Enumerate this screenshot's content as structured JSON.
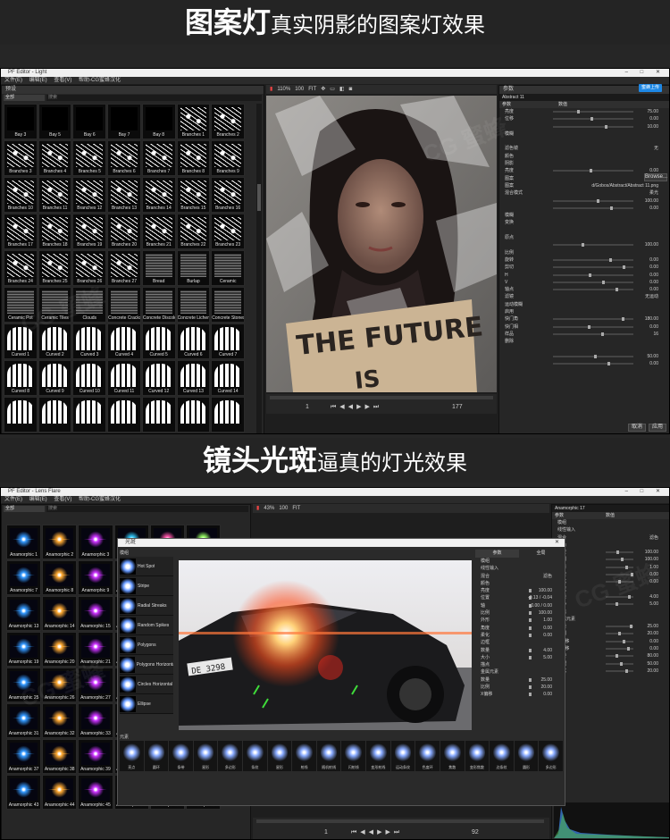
{
  "banner1": {
    "bold": "图案灯",
    "normal": "真实阴影的图案灯效果"
  },
  "banner2": {
    "bold": "镜头光斑",
    "normal": "逼真的灯光效果"
  },
  "shot1": {
    "title": "PF Editor - Light",
    "menu": [
      "文件(E)",
      "编辑(E)",
      "查看(V)",
      "帮助-CG蜜蜂汉化"
    ],
    "presets_title": "预设",
    "filter_value": "全部",
    "search_placeholder": "搜索",
    "toolbar": {
      "zoom": "110%",
      "size": "100",
      "fit": "FIT"
    },
    "gobos": [
      "Bay 3",
      "Bay 5",
      "Bay 6",
      "Bay 7",
      "Bay 8",
      "Branches 1",
      "Branches 2",
      "Branches 3",
      "Branches 4",
      "Branches 5",
      "Branches 6",
      "Branches 7",
      "Branches 8",
      "Branches 9",
      "Branches 10",
      "Branches 11",
      "Branches 12",
      "Branches 13",
      "Branches 14",
      "Branches 15",
      "Branches 16",
      "Branches 17",
      "Branches 18",
      "Branches 19",
      "Branches 20",
      "Branches 21",
      "Branches 22",
      "Branches 23",
      "Branches 24",
      "Branches 25",
      "Branches 26",
      "Branches 27",
      "Bread",
      "Burlap",
      "Ceramic",
      "Ceramic Pot",
      "Ceramic Tiles",
      "Clouds",
      "Concrete Cracks",
      "Concrete Discolored",
      "Concrete Lichens",
      "Concrete Stones",
      "Curved 1",
      "Curved 2",
      "Curved 3",
      "Curved 4",
      "Curved 5",
      "Curved 6",
      "Curved 7",
      "Curved 8",
      "Curved 9",
      "Curved 10",
      "Curved 11",
      "Curved 12",
      "Curved 13",
      "Curved 14",
      "",
      "",
      "",
      "",
      "",
      "",
      ""
    ],
    "sign_text_1": "THE FUTURE",
    "sign_text_2": "IS",
    "timeline": {
      "start": "1",
      "end": "177"
    },
    "props": {
      "title": "参数",
      "badge": "蜜蜂上传",
      "preset_name": "Abstract 11",
      "col_param": "参数",
      "col_value": "数值",
      "rows": [
        {
          "label": "亮度",
          "value": "75.00"
        },
        {
          "label": "位移",
          "value": "0.00"
        },
        {
          "label": "",
          "value": "10.00"
        },
        {
          "label": "模糊",
          "value": ""
        },
        {
          "label": "",
          "value": ""
        },
        {
          "label": "滤色镜",
          "value": "无"
        },
        {
          "label": "颜色",
          "value": ""
        },
        {
          "label": "阴影",
          "value": ""
        },
        {
          "label": "亮度",
          "value": "0.00"
        },
        {
          "label": "图案",
          "value": ""
        },
        {
          "label": "图案",
          "value": "d/Gobos/Abstract/Abstract 11.png"
        },
        {
          "label": "混合模式",
          "value": "柔光"
        },
        {
          "label": "",
          "value": "100.00"
        },
        {
          "label": "",
          "value": "0.00"
        },
        {
          "label": "模糊",
          "value": ""
        },
        {
          "label": "变换",
          "value": ""
        },
        {
          "label": "",
          "value": ""
        },
        {
          "label": "原点",
          "value": ""
        },
        {
          "label": "",
          "value": "100.00"
        },
        {
          "label": "比例",
          "value": ""
        },
        {
          "label": "旋转",
          "value": "0.00"
        },
        {
          "label": "剪切",
          "value": "0.00"
        },
        {
          "label": "H",
          "value": "0.00"
        },
        {
          "label": "V",
          "value": "0.00"
        },
        {
          "label": "轴点",
          "value": "0.00"
        },
        {
          "label": "滤镜",
          "value": "无运动"
        },
        {
          "label": "运动模糊",
          "value": ""
        },
        {
          "label": "启用",
          "value": ""
        },
        {
          "label": "快门角",
          "value": "180.00"
        },
        {
          "label": "快门相",
          "value": "0.00"
        },
        {
          "label": "样品",
          "value": "16"
        },
        {
          "label": "删除",
          "value": ""
        },
        {
          "label": "",
          "value": ""
        },
        {
          "label": "",
          "value": "50.00"
        },
        {
          "label": "",
          "value": "0.00"
        }
      ],
      "browse": "Browse...",
      "cancel": "取消",
      "apply": "应用"
    }
  },
  "shot2": {
    "title": "PF Editor - Lens Flare",
    "menu": [
      "文件(E)",
      "编辑(E)",
      "查看(V)",
      "帮助-CG蜜蜂汉化"
    ],
    "filter_value": "全部",
    "search_placeholder": "搜索",
    "toolbar": {
      "zoom": "43%",
      "size": "100",
      "fit": "FIT"
    },
    "flares": [
      "Anamorphic 1",
      "Anamorphic 2",
      "Anamorphic 3",
      "Anamorphic 4",
      "Anamorphic 5",
      "Anamorphic 6",
      "Anamorphic 7",
      "Anamorphic 8",
      "Anamorphic 9",
      "Anamorphic 10",
      "Anamorphic 11",
      "Anamorphic 12",
      "Anamorphic 13",
      "Anamorphic 14",
      "Anamorphic 15",
      "Anamorphic 16",
      "Anamorphic 17",
      "Anamorphic 18",
      "Anamorphic 19",
      "Anamorphic 20",
      "Anamorphic 21",
      "Anamorphic 22",
      "Anamorphic 23",
      "Anamorphic 24",
      "Anamorphic 25",
      "Anamorphic 26",
      "Anamorphic 27",
      "Anamorphic 28",
      "Anamorphic 29",
      "Anamorphic 30",
      "Anamorphic 31",
      "Anamorphic 32",
      "Anamorphic 33",
      "Anamorphic 34",
      "Anamorphic 35",
      "Anamorphic 36",
      "Anamorphic 37",
      "Anamorphic 38",
      "Anamorphic 39",
      "Anamorphic 40",
      "Anamorphic 41",
      "Anamorphic 42",
      "Anamorphic 43",
      "Anamorphic 44",
      "Anamorphic 45",
      "Anamorphic 46",
      "Anamorphic 47",
      "Anamorphic 48"
    ],
    "dialog": {
      "title": "光斑",
      "elements_title": "模组",
      "elements": [
        "Hot Spot",
        "Stripe",
        "Radial Streaks",
        "Random Spikes",
        "Polygons",
        "Polygons Horizontal",
        "Circles Horizontal",
        "Ellipse"
      ],
      "tabs": [
        "参数",
        "全局"
      ],
      "plate": "DE 3298",
      "params": [
        {
          "label": "模组",
          "value": ""
        },
        {
          "label": "线性输入",
          "value": ""
        },
        {
          "label": "混合",
          "value": "滤色"
        },
        {
          "label": "颜色",
          "value": ""
        },
        {
          "label": "亮度",
          "value": "100.00"
        },
        {
          "label": "位置",
          "value": "-0.13 / -0.04"
        },
        {
          "label": "轴",
          "value": "0.00 / 0.00"
        },
        {
          "label": "比例",
          "value": "100.00"
        },
        {
          "label": "外形",
          "value": "1.00"
        },
        {
          "label": "角度",
          "value": "0.00"
        },
        {
          "label": "柔化",
          "value": "0.00"
        },
        {
          "label": "边框",
          "value": ""
        },
        {
          "label": "数量",
          "value": "4.00"
        },
        {
          "label": "大小",
          "value": "5.00"
        },
        {
          "label": "描点",
          "value": ""
        },
        {
          "label": "金属元素",
          "value": ""
        },
        {
          "label": "数量",
          "value": "25.00"
        },
        {
          "label": "比例",
          "value": "20.00"
        },
        {
          "label": "X偏移",
          "value": "0.00"
        }
      ],
      "strip_title": "元素",
      "strip": [
        "亮点",
        "圆环",
        "条带",
        "星形",
        "多边形",
        "条纹",
        "星形",
        "射线",
        "随机射线",
        "闪射线",
        "变形射线",
        "运动条纹",
        "色度环",
        "焦散",
        "变形焦散",
        "边条纹",
        "圆形",
        "多边形"
      ]
    },
    "props": {
      "preset_name": "Anamorphic 17",
      "col_param": "参数",
      "col_value": "数值",
      "rows": [
        {
          "label": "模组",
          "value": ""
        },
        {
          "label": "线性输入",
          "value": ""
        },
        {
          "label": "混合",
          "value": "滤色"
        },
        {
          "label": "颜色",
          "value": ""
        },
        {
          "label": "亮度",
          "value": "100.00"
        },
        {
          "label": "比例",
          "value": "100.00"
        },
        {
          "label": "外形",
          "value": "1.00"
        },
        {
          "label": "角度",
          "value": "0.00"
        },
        {
          "label": "柔化",
          "value": "0.00"
        },
        {
          "label": "边框",
          "value": ""
        },
        {
          "label": "数量",
          "value": "4.00"
        },
        {
          "label": "大小",
          "value": "5.00"
        },
        {
          "label": "描点",
          "value": ""
        },
        {
          "label": "金属元素",
          "value": ""
        },
        {
          "label": "数量",
          "value": "25.00"
        },
        {
          "label": "比例",
          "value": "20.00"
        },
        {
          "label": "X偏移",
          "value": "0.00"
        },
        {
          "label": "Y偏移",
          "value": "0.00"
        },
        {
          "label": "旋转",
          "value": "80.00"
        },
        {
          "label": "纹理",
          "value": "50.00"
        },
        {
          "label": "柔化",
          "value": "20.00"
        }
      ],
      "cancel": "取消",
      "apply": "应用"
    },
    "timeline": {
      "start": "1",
      "end": "92"
    }
  },
  "watermark": "CG 蜜蜂",
  "watermark_url": "www.cgbee.com"
}
